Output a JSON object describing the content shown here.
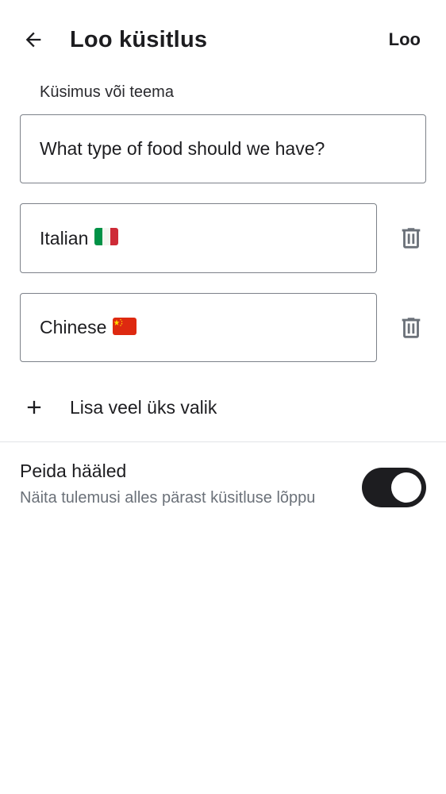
{
  "appbar": {
    "back_icon": "arrow-left-icon",
    "title": "Loo küsitlus",
    "create_label": "Loo"
  },
  "question": {
    "label": "Küsimus või teema",
    "value": "What type of food should we have?"
  },
  "options": [
    {
      "value": "Italian",
      "flag": "italy-flag-icon",
      "delete_icon": "trash-icon"
    },
    {
      "value": "Chinese",
      "flag": "china-flag-icon",
      "delete_icon": "trash-icon"
    }
  ],
  "add_option": {
    "icon": "plus-icon",
    "label": "Lisa veel üks valik"
  },
  "hide_votes": {
    "title": "Peida hääled",
    "description": "Näita tulemusi alles pärast küsitluse lõppu",
    "enabled": true
  },
  "colors": {
    "text": "#1d1d20",
    "secondary_text": "#6b7179",
    "border": "#7c8189",
    "icon_gray": "#6b7179",
    "toggle_on": "#1d1d20"
  }
}
